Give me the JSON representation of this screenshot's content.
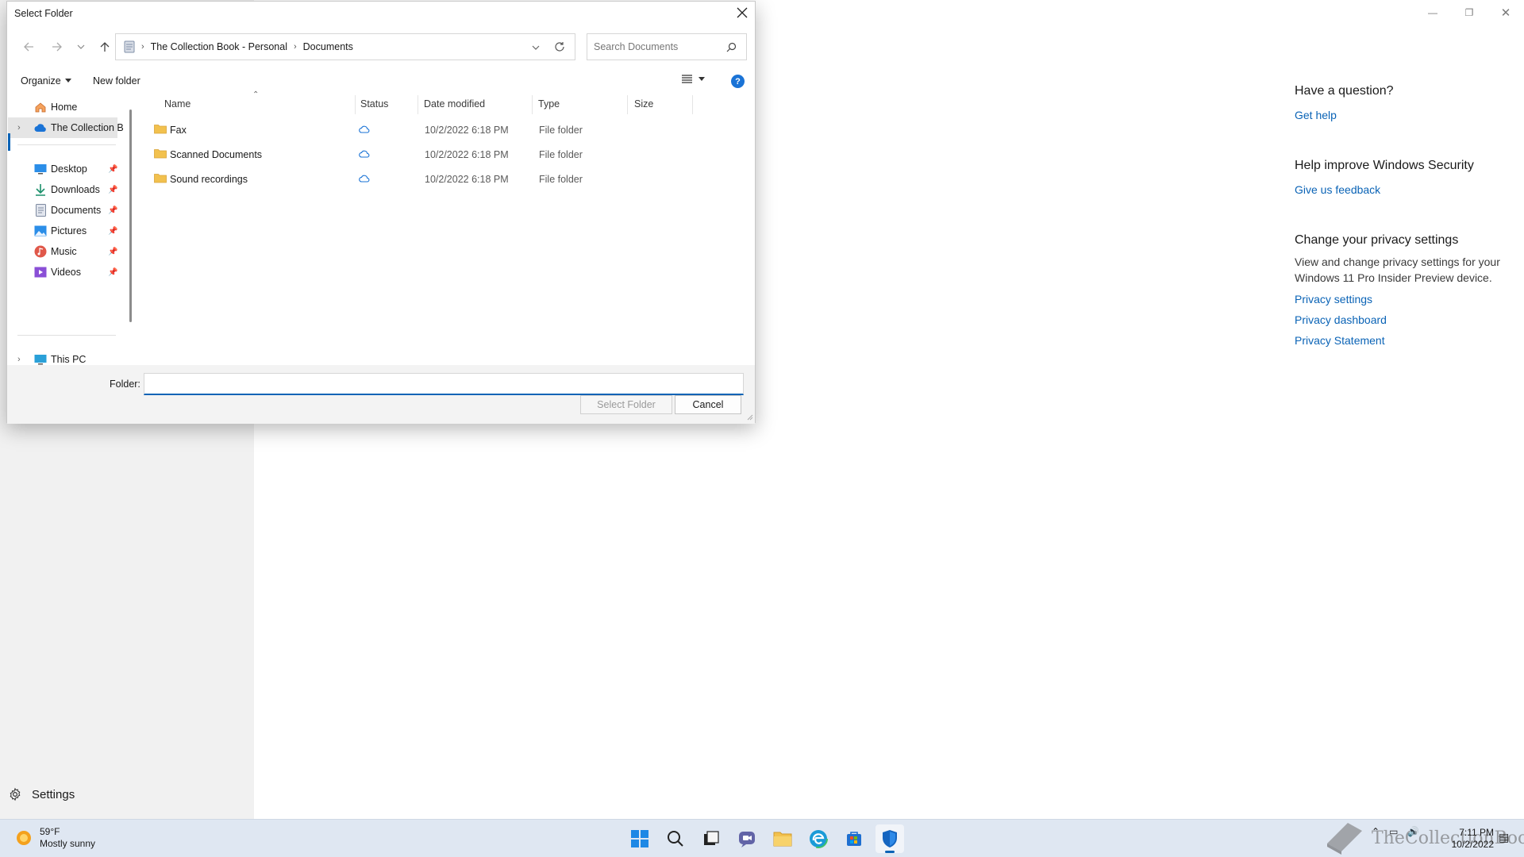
{
  "app": {
    "sidebar": {
      "settings_label": "Settings"
    },
    "right_panel": {
      "question_heading": "Have a question?",
      "get_help": "Get help",
      "improve_heading": "Help improve Windows Security",
      "feedback": "Give us feedback",
      "privacy_heading": "Change your privacy settings",
      "privacy_text": "View and change privacy settings for your Windows 11 Pro Insider Preview device.",
      "privacy_settings": "Privacy settings",
      "privacy_dashboard": "Privacy dashboard",
      "privacy_statement": "Privacy Statement"
    }
  },
  "dialog": {
    "title": "Select Folder",
    "breadcrumb": [
      "The Collection Book - Personal",
      "Documents"
    ],
    "search_placeholder": "Search Documents",
    "organize_label": "Organize",
    "new_folder_label": "New folder",
    "nav": {
      "home": "Home",
      "onedrive": "The Collection B",
      "desktop": "Desktop",
      "downloads": "Downloads",
      "documents": "Documents",
      "pictures": "Pictures",
      "music": "Music",
      "videos": "Videos",
      "this_pc": "This PC"
    },
    "columns": {
      "name": "Name",
      "status": "Status",
      "date": "Date modified",
      "type": "Type",
      "size": "Size"
    },
    "files": [
      {
        "name": "Fax",
        "date": "10/2/2022 6:18 PM",
        "type": "File folder"
      },
      {
        "name": "Scanned Documents",
        "date": "10/2/2022 6:18 PM",
        "type": "File folder"
      },
      {
        "name": "Sound recordings",
        "date": "10/2/2022 6:18 PM",
        "type": "File folder"
      }
    ],
    "folder_label": "Folder:",
    "folder_value": "",
    "select_button": "Select Folder",
    "cancel_button": "Cancel"
  },
  "taskbar": {
    "weather_temp": "59°F",
    "weather_desc": "Mostly sunny",
    "time": "7:11 PM",
    "date": "10/2/2022",
    "watermark": "TheCollectionBook"
  },
  "colors": {
    "accent": "#0a63b6",
    "folder": "#f2c14e",
    "taskbar": "#dfe7f2"
  }
}
